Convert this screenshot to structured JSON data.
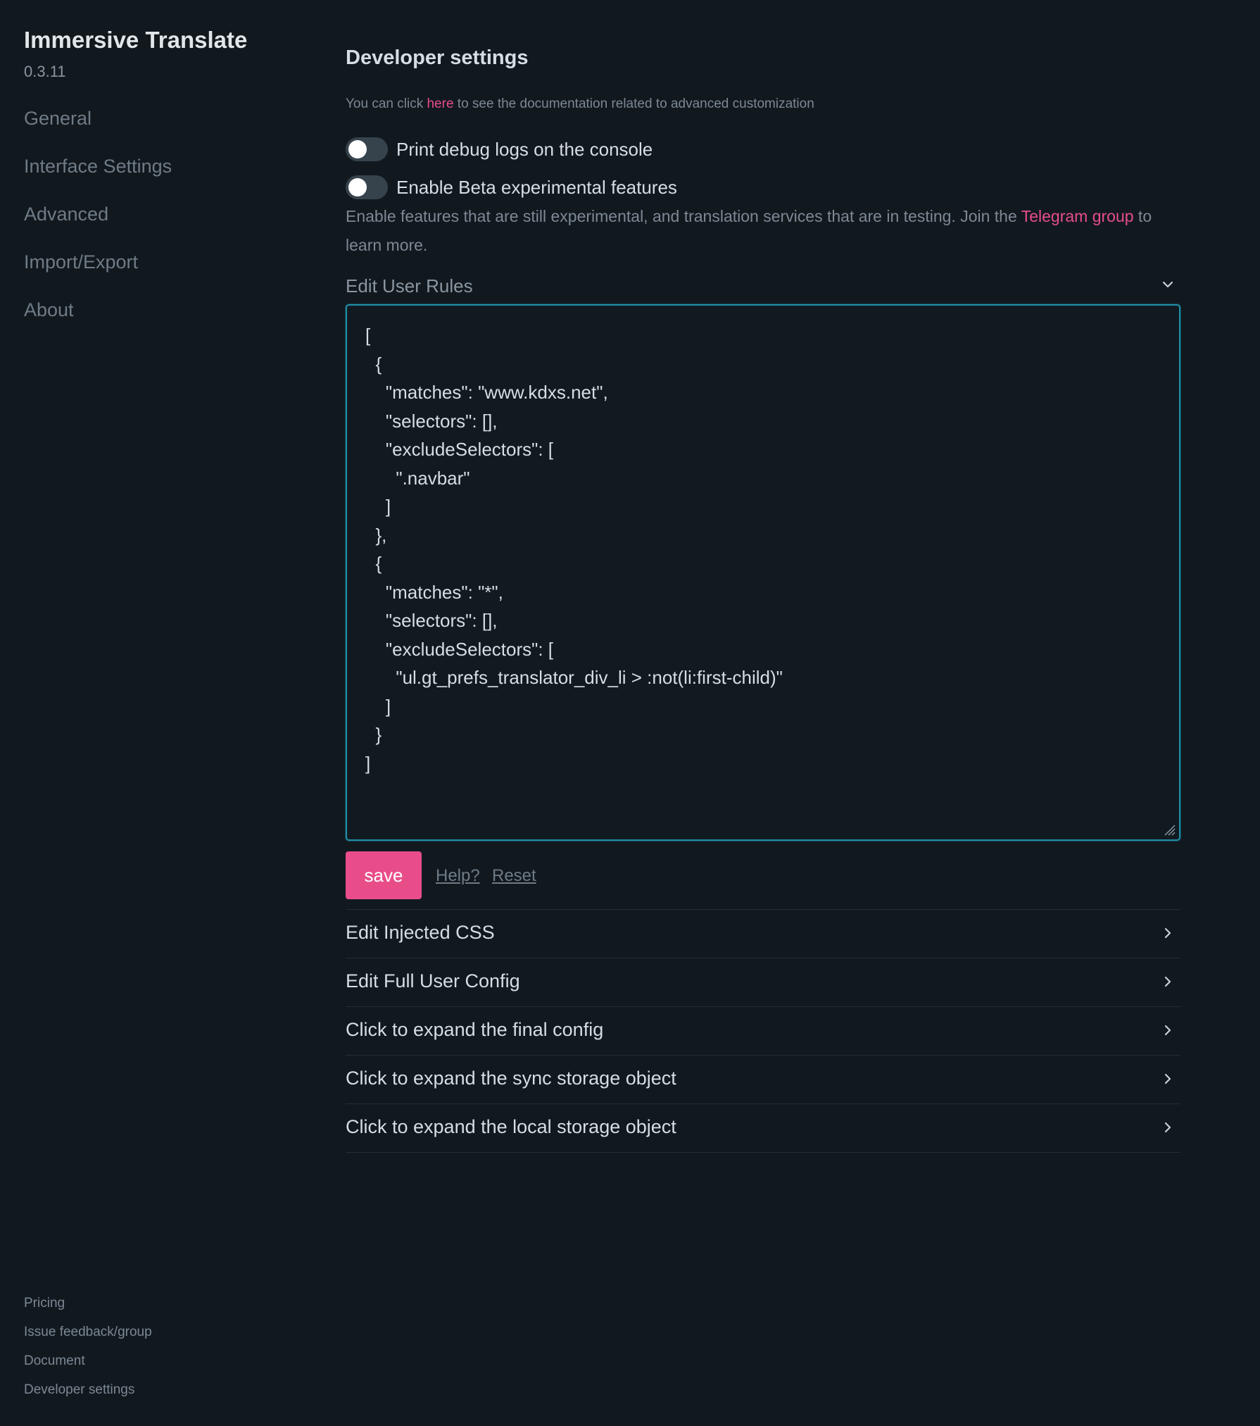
{
  "sidebar": {
    "title": "Immersive Translate",
    "version": "0.3.11",
    "nav": [
      {
        "label": "General"
      },
      {
        "label": "Interface Settings"
      },
      {
        "label": "Advanced"
      },
      {
        "label": "Import/Export"
      },
      {
        "label": "About"
      }
    ],
    "footer": [
      {
        "label": "Pricing"
      },
      {
        "label": "Issue feedback/group"
      },
      {
        "label": "Document"
      },
      {
        "label": "Developer settings"
      }
    ]
  },
  "main": {
    "title": "Developer settings",
    "doc_note": {
      "before": "You can click ",
      "link": "here",
      "after": " to see the documentation related to advanced customization"
    },
    "toggles": [
      {
        "label": "Print debug logs on the console",
        "checked": false
      },
      {
        "label": "Enable Beta experimental features",
        "checked": false
      }
    ],
    "beta_desc": {
      "before": "Enable features that are still experimental, and translation services that are in testing. Join the ",
      "link": "Telegram group",
      "after": " to learn more."
    },
    "user_rules": {
      "header": "Edit User Rules",
      "value": "[\n  {\n    \"matches\": \"www.kdxs.net\",\n    \"selectors\": [],\n    \"excludeSelectors\": [\n      \".navbar\"\n    ]\n  },\n  {\n    \"matches\": \"*\",\n    \"selectors\": [],\n    \"excludeSelectors\": [\n      \"ul.gt_prefs_translator_div_li > :not(li:first-child)\"\n    ]\n  }\n]"
    },
    "actions": {
      "save": "save",
      "help": "Help?",
      "reset": "Reset"
    },
    "sections": [
      {
        "label": "Edit Injected CSS"
      },
      {
        "label": "Edit Full User Config"
      },
      {
        "label": "Click to expand the final config"
      },
      {
        "label": "Click to expand the sync storage object"
      },
      {
        "label": "Click to expand the local storage object"
      }
    ]
  },
  "colors": {
    "background": "#11191f",
    "accent": "#e84d8a",
    "focus_border": "#1f8ea6"
  }
}
